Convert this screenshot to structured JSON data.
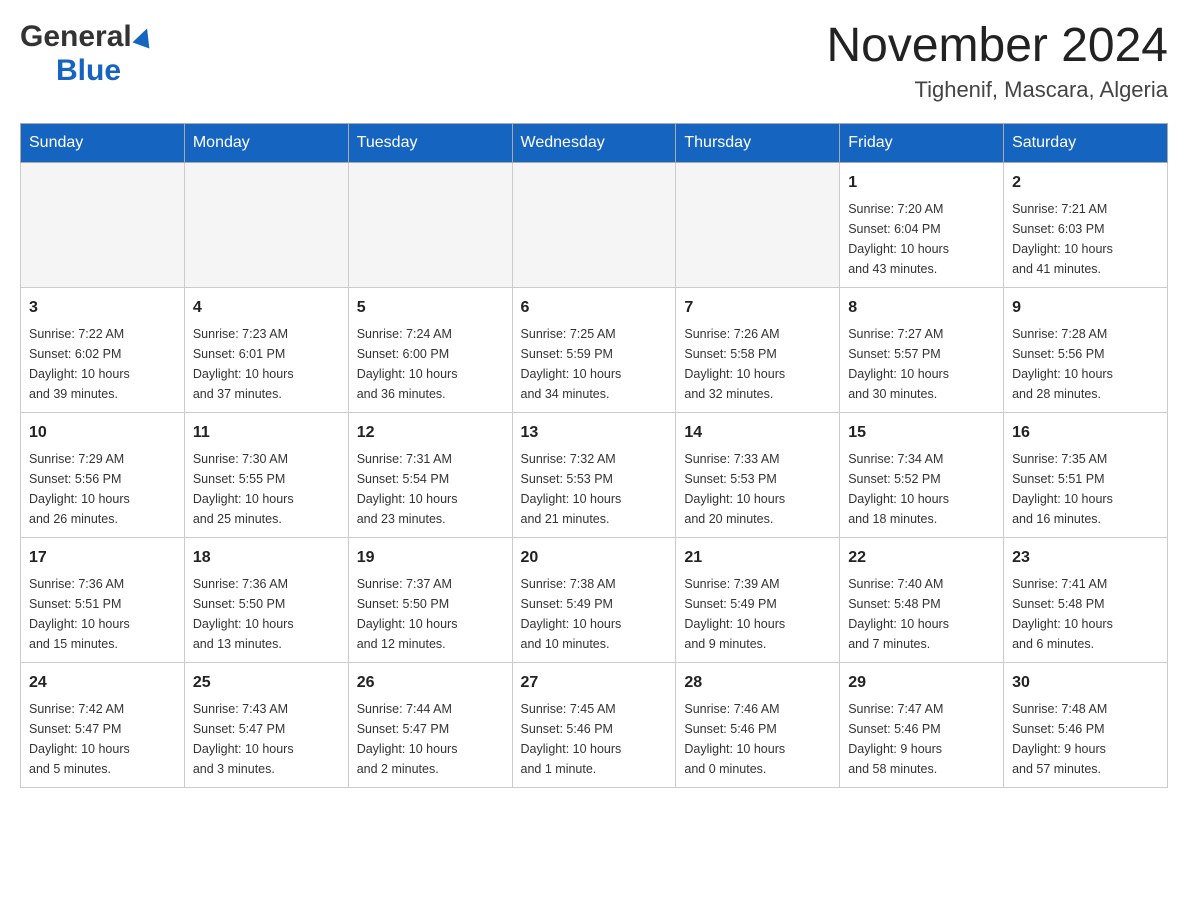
{
  "header": {
    "logo_general": "General",
    "logo_blue": "Blue",
    "month_year": "November 2024",
    "location": "Tighenif, Mascara, Algeria"
  },
  "days_of_week": [
    "Sunday",
    "Monday",
    "Tuesday",
    "Wednesday",
    "Thursday",
    "Friday",
    "Saturday"
  ],
  "weeks": [
    [
      {
        "day": "",
        "info": ""
      },
      {
        "day": "",
        "info": ""
      },
      {
        "day": "",
        "info": ""
      },
      {
        "day": "",
        "info": ""
      },
      {
        "day": "",
        "info": ""
      },
      {
        "day": "1",
        "info": "Sunrise: 7:20 AM\nSunset: 6:04 PM\nDaylight: 10 hours\nand 43 minutes."
      },
      {
        "day": "2",
        "info": "Sunrise: 7:21 AM\nSunset: 6:03 PM\nDaylight: 10 hours\nand 41 minutes."
      }
    ],
    [
      {
        "day": "3",
        "info": "Sunrise: 7:22 AM\nSunset: 6:02 PM\nDaylight: 10 hours\nand 39 minutes."
      },
      {
        "day": "4",
        "info": "Sunrise: 7:23 AM\nSunset: 6:01 PM\nDaylight: 10 hours\nand 37 minutes."
      },
      {
        "day": "5",
        "info": "Sunrise: 7:24 AM\nSunset: 6:00 PM\nDaylight: 10 hours\nand 36 minutes."
      },
      {
        "day": "6",
        "info": "Sunrise: 7:25 AM\nSunset: 5:59 PM\nDaylight: 10 hours\nand 34 minutes."
      },
      {
        "day": "7",
        "info": "Sunrise: 7:26 AM\nSunset: 5:58 PM\nDaylight: 10 hours\nand 32 minutes."
      },
      {
        "day": "8",
        "info": "Sunrise: 7:27 AM\nSunset: 5:57 PM\nDaylight: 10 hours\nand 30 minutes."
      },
      {
        "day": "9",
        "info": "Sunrise: 7:28 AM\nSunset: 5:56 PM\nDaylight: 10 hours\nand 28 minutes."
      }
    ],
    [
      {
        "day": "10",
        "info": "Sunrise: 7:29 AM\nSunset: 5:56 PM\nDaylight: 10 hours\nand 26 minutes."
      },
      {
        "day": "11",
        "info": "Sunrise: 7:30 AM\nSunset: 5:55 PM\nDaylight: 10 hours\nand 25 minutes."
      },
      {
        "day": "12",
        "info": "Sunrise: 7:31 AM\nSunset: 5:54 PM\nDaylight: 10 hours\nand 23 minutes."
      },
      {
        "day": "13",
        "info": "Sunrise: 7:32 AM\nSunset: 5:53 PM\nDaylight: 10 hours\nand 21 minutes."
      },
      {
        "day": "14",
        "info": "Sunrise: 7:33 AM\nSunset: 5:53 PM\nDaylight: 10 hours\nand 20 minutes."
      },
      {
        "day": "15",
        "info": "Sunrise: 7:34 AM\nSunset: 5:52 PM\nDaylight: 10 hours\nand 18 minutes."
      },
      {
        "day": "16",
        "info": "Sunrise: 7:35 AM\nSunset: 5:51 PM\nDaylight: 10 hours\nand 16 minutes."
      }
    ],
    [
      {
        "day": "17",
        "info": "Sunrise: 7:36 AM\nSunset: 5:51 PM\nDaylight: 10 hours\nand 15 minutes."
      },
      {
        "day": "18",
        "info": "Sunrise: 7:36 AM\nSunset: 5:50 PM\nDaylight: 10 hours\nand 13 minutes."
      },
      {
        "day": "19",
        "info": "Sunrise: 7:37 AM\nSunset: 5:50 PM\nDaylight: 10 hours\nand 12 minutes."
      },
      {
        "day": "20",
        "info": "Sunrise: 7:38 AM\nSunset: 5:49 PM\nDaylight: 10 hours\nand 10 minutes."
      },
      {
        "day": "21",
        "info": "Sunrise: 7:39 AM\nSunset: 5:49 PM\nDaylight: 10 hours\nand 9 minutes."
      },
      {
        "day": "22",
        "info": "Sunrise: 7:40 AM\nSunset: 5:48 PM\nDaylight: 10 hours\nand 7 minutes."
      },
      {
        "day": "23",
        "info": "Sunrise: 7:41 AM\nSunset: 5:48 PM\nDaylight: 10 hours\nand 6 minutes."
      }
    ],
    [
      {
        "day": "24",
        "info": "Sunrise: 7:42 AM\nSunset: 5:47 PM\nDaylight: 10 hours\nand 5 minutes."
      },
      {
        "day": "25",
        "info": "Sunrise: 7:43 AM\nSunset: 5:47 PM\nDaylight: 10 hours\nand 3 minutes."
      },
      {
        "day": "26",
        "info": "Sunrise: 7:44 AM\nSunset: 5:47 PM\nDaylight: 10 hours\nand 2 minutes."
      },
      {
        "day": "27",
        "info": "Sunrise: 7:45 AM\nSunset: 5:46 PM\nDaylight: 10 hours\nand 1 minute."
      },
      {
        "day": "28",
        "info": "Sunrise: 7:46 AM\nSunset: 5:46 PM\nDaylight: 10 hours\nand 0 minutes."
      },
      {
        "day": "29",
        "info": "Sunrise: 7:47 AM\nSunset: 5:46 PM\nDaylight: 9 hours\nand 58 minutes."
      },
      {
        "day": "30",
        "info": "Sunrise: 7:48 AM\nSunset: 5:46 PM\nDaylight: 9 hours\nand 57 minutes."
      }
    ]
  ]
}
